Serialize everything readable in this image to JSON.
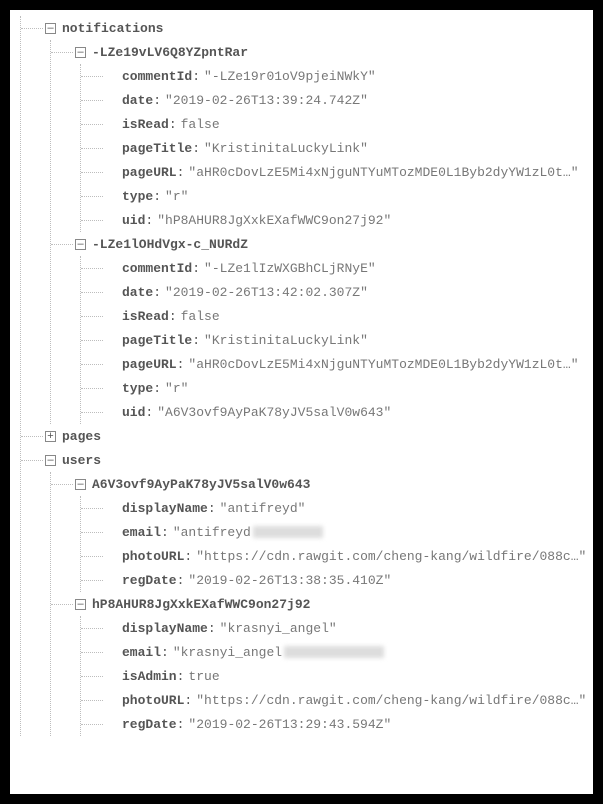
{
  "tree": [
    {
      "key": "notifications",
      "expanded": true,
      "children": [
        {
          "key": "-LZe19vLV6Q8YZpntRar",
          "expanded": true,
          "children": [
            {
              "key": "commentId",
              "value": "-LZe19r01oV9pjeiNWkY",
              "type": "str"
            },
            {
              "key": "date",
              "value": "2019-02-26T13:39:24.742Z",
              "type": "str"
            },
            {
              "key": "isRead",
              "value": "false",
              "type": "raw"
            },
            {
              "key": "pageTitle",
              "value": "KristinitaLuckyLink",
              "type": "str"
            },
            {
              "key": "pageURL",
              "value": "aHR0cDovLzE5Mi4xNjguNTYuMTozMDE0L1Byb2dyYW1zL0t…",
              "type": "str"
            },
            {
              "key": "type",
              "value": "r",
              "type": "str"
            },
            {
              "key": "uid",
              "value": "hP8AHUR8JgXxkEXafWWC9on27j92",
              "type": "str"
            }
          ]
        },
        {
          "key": "-LZe1lOHdVgx-c_NURdZ",
          "expanded": true,
          "children": [
            {
              "key": "commentId",
              "value": "-LZe1lIzWXGBhCLjRNyE",
              "type": "str"
            },
            {
              "key": "date",
              "value": "2019-02-26T13:42:02.307Z",
              "type": "str"
            },
            {
              "key": "isRead",
              "value": "false",
              "type": "raw"
            },
            {
              "key": "pageTitle",
              "value": "KristinitaLuckyLink",
              "type": "str"
            },
            {
              "key": "pageURL",
              "value": "aHR0cDovLzE5Mi4xNjguNTYuMTozMDE0L1Byb2dyYW1zL0t…",
              "type": "str"
            },
            {
              "key": "type",
              "value": "r",
              "type": "str"
            },
            {
              "key": "uid",
              "value": "A6V3ovf9AyPaK78yJV5salV0w643",
              "type": "str"
            }
          ]
        }
      ]
    },
    {
      "key": "pages",
      "expanded": false
    },
    {
      "key": "users",
      "expanded": true,
      "children": [
        {
          "key": "A6V3ovf9AyPaK78yJV5salV0w643",
          "expanded": true,
          "children": [
            {
              "key": "displayName",
              "value": "antifreyd",
              "type": "str"
            },
            {
              "key": "email",
              "value": "antifreyd",
              "type": "blur"
            },
            {
              "key": "photoURL",
              "value": "https://cdn.rawgit.com/cheng-kang/wildfire/088c…",
              "type": "str"
            },
            {
              "key": "regDate",
              "value": "2019-02-26T13:38:35.410Z",
              "type": "str"
            }
          ]
        },
        {
          "key": "hP8AHUR8JgXxkEXafWWC9on27j92",
          "expanded": true,
          "children": [
            {
              "key": "displayName",
              "value": "krasnyi_angel",
              "type": "str"
            },
            {
              "key": "email",
              "value": "krasnyi_angel",
              "type": "blur-wide"
            },
            {
              "key": "isAdmin",
              "value": "true",
              "type": "raw"
            },
            {
              "key": "photoURL",
              "value": "https://cdn.rawgit.com/cheng-kang/wildfire/088c…",
              "type": "str"
            },
            {
              "key": "regDate",
              "value": "2019-02-26T13:29:43.594Z",
              "type": "str"
            }
          ]
        }
      ]
    }
  ]
}
